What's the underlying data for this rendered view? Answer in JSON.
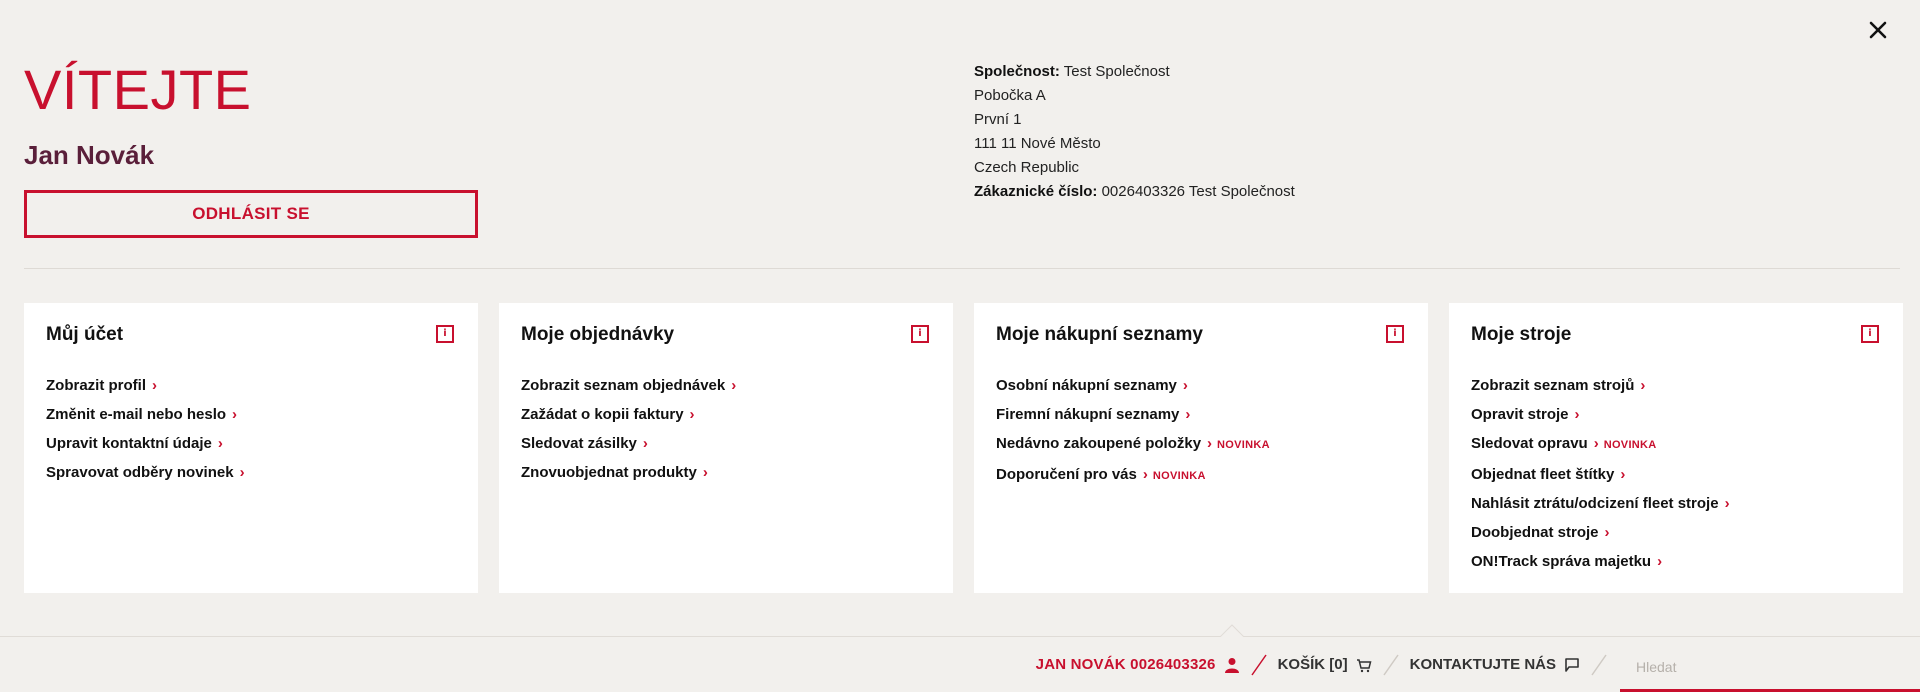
{
  "welcome": {
    "title": "VÍTEJTE",
    "user_name": "Jan Novák",
    "logout_label": "ODHLÁSIT SE"
  },
  "company": {
    "company_label": "Společnost:",
    "company_name": "Test Společnost",
    "branch": "Pobočka A",
    "street": "První 1",
    "city": "111 11 Nové Město",
    "country": "Czech Republic",
    "customer_label": "Zákaznické číslo:",
    "customer_value": "0026403326 Test Společnost"
  },
  "cards": [
    {
      "title": "Můj účet",
      "links": [
        {
          "label": "Zobrazit profil"
        },
        {
          "label": "Změnit e-mail nebo heslo"
        },
        {
          "label": "Upravit kontaktní údaje"
        },
        {
          "label": "Spravovat odběry novinek"
        }
      ]
    },
    {
      "title": "Moje objednávky",
      "links": [
        {
          "label": "Zobrazit seznam objednávek"
        },
        {
          "label": "Zažádat o kopii faktury"
        },
        {
          "label": "Sledovat zásilky"
        },
        {
          "label": "Znovuobjednat produkty"
        }
      ]
    },
    {
      "title": "Moje nákupní seznamy",
      "links": [
        {
          "label": "Osobní nákupní seznamy"
        },
        {
          "label": "Firemní nákupní seznamy"
        },
        {
          "label": "Nedávno zakoupené položky",
          "badge": "NOVINKA"
        },
        {
          "label": "Doporučení pro vás",
          "badge": "NOVINKA"
        }
      ]
    },
    {
      "title": "Moje stroje",
      "links": [
        {
          "label": "Zobrazit seznam strojů"
        },
        {
          "label": "Opravit stroje"
        },
        {
          "label": "Sledovat opravu",
          "badge": "NOVINKA"
        },
        {
          "label": "Objednat fleet štítky"
        },
        {
          "label": "Nahlásit ztrátu/odcizení fleet stroje"
        },
        {
          "label": "Doobjednat stroje"
        },
        {
          "label": "ON!Track správa majetku"
        }
      ]
    }
  ],
  "icons": {
    "close": "close-icon",
    "info": "info-icon",
    "chevron": "chevron-right-icon",
    "user": "user-icon",
    "cart": "cart-icon",
    "chat": "chat-icon"
  },
  "bottom_bar": {
    "account": "JAN NOVÁK 0026403326",
    "cart": "KOŠÍK [0]",
    "contact": "KONTAKTUJTE NÁS",
    "search_placeholder": "Hledat"
  },
  "colors": {
    "accent": "#c8102e",
    "background": "#f2f0ed",
    "card": "#ffffff",
    "name": "#5a1f3a"
  }
}
